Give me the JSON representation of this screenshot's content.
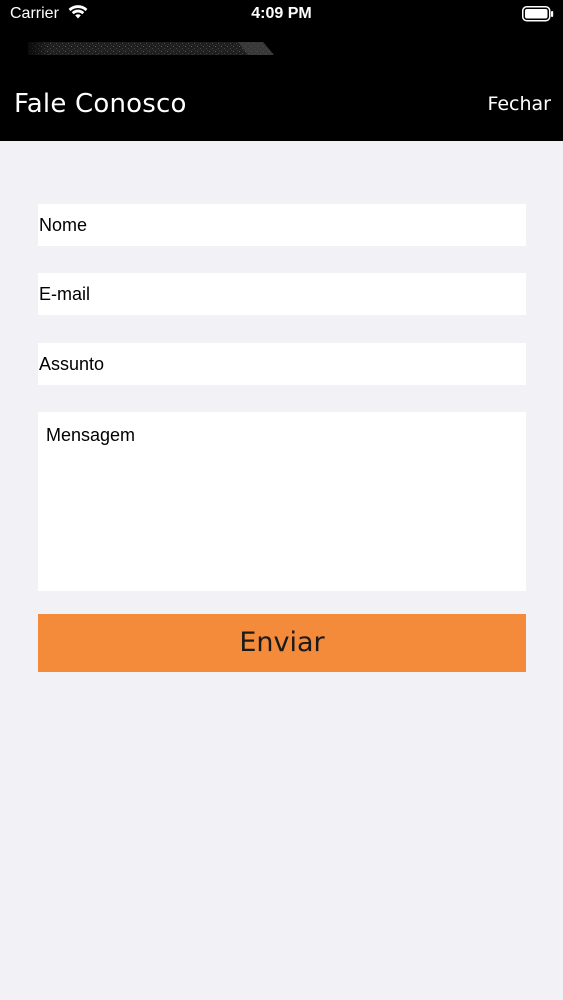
{
  "status_bar": {
    "carrier": "Carrier",
    "time": "4:09 PM",
    "wifi_icon": "wifi-icon",
    "battery_icon": "battery-full-icon"
  },
  "nav": {
    "title": "Fale Conosco",
    "close_label": "Fechar"
  },
  "form": {
    "name_placeholder": "Nome",
    "email_placeholder": "E-mail",
    "subject_placeholder": "Assunto",
    "message_placeholder": "Mensagem",
    "submit_label": "Enviar"
  },
  "colors": {
    "header_background": "#000000",
    "page_background": "#f2f1f6",
    "accent": "#f48b3a"
  }
}
